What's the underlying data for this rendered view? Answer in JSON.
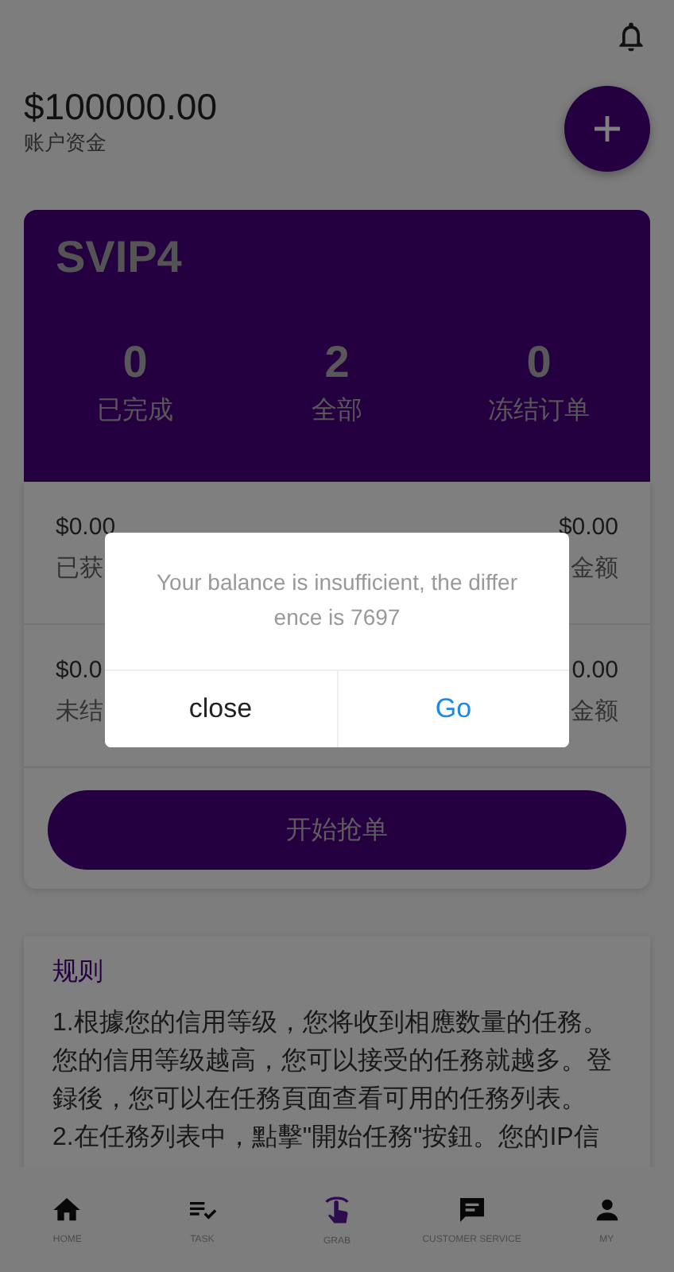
{
  "account": {
    "balance": "$100000.00",
    "label": "账户资金"
  },
  "vip_card": {
    "level": "SVIP4",
    "stats": [
      {
        "value": "0",
        "label": "已完成"
      },
      {
        "value": "2",
        "label": "全部"
      },
      {
        "value": "0",
        "label": "冻结订单"
      }
    ]
  },
  "summary_rows": [
    {
      "left_value": "$0.00",
      "left_label": "已获",
      "right_value": "$0.00",
      "right_label": "金额"
    },
    {
      "left_value": "$0.0",
      "left_label": "未结",
      "right_value": "0.00",
      "right_label": "金额"
    }
  ],
  "start_button": "开始抢单",
  "rules": {
    "title": "规则",
    "paragraphs": [
      "1.根據您的信用等级，您将收到相應数量的任務。您的信用等级越高，您可以接受的任務就越多。登録後，您可以在任務頁面查看可用的任務列表。",
      "2.在任務列表中，點擊\"開始任務\"按鈕。您的IP信"
    ]
  },
  "bottom_nav": [
    {
      "label": "HOME",
      "kind": "home",
      "selected": false
    },
    {
      "label": "TASK",
      "kind": "task",
      "selected": false
    },
    {
      "label": "GRAB",
      "kind": "grab",
      "selected": true
    },
    {
      "label": "CUSTOMER SERVICE",
      "kind": "chat",
      "selected": false
    },
    {
      "label": "MY",
      "kind": "person",
      "selected": false
    }
  ],
  "dialog": {
    "message": "Your balance is insufficient, the differ ence is 7697",
    "buttons": [
      {
        "label": "close",
        "kind": "cancel"
      },
      {
        "label": "Go",
        "kind": "confirm"
      }
    ]
  }
}
